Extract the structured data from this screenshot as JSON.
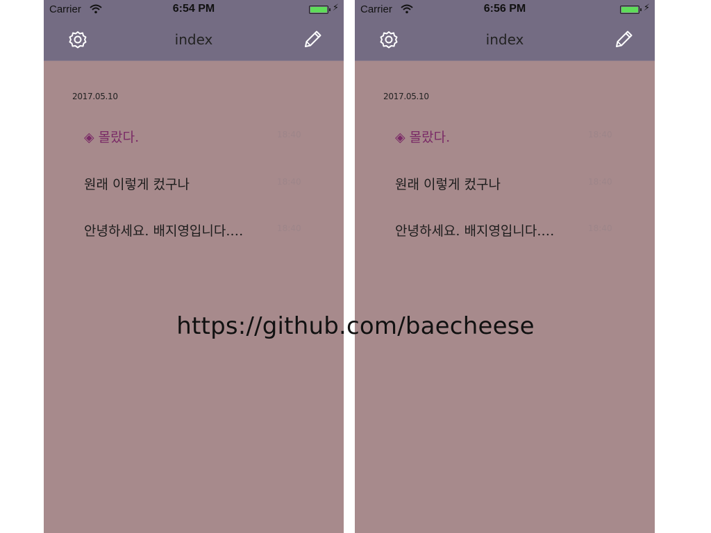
{
  "screens": [
    {
      "status": {
        "carrier": "Carrier",
        "time": "6:54 PM"
      },
      "nav": {
        "title": "index"
      },
      "list": {
        "date": "2017.05.10",
        "items": [
          {
            "marker": "◈",
            "title": "몰랐다.",
            "time": "18:40"
          },
          {
            "title": "원래 이렇게 컸구나",
            "time": "18:40"
          },
          {
            "title": "안녕하세요. 배지영입니다.…",
            "time": "18:40"
          }
        ]
      }
    },
    {
      "status": {
        "carrier": "Carrier",
        "time": "6:56 PM"
      },
      "nav": {
        "title": "index"
      },
      "list": {
        "date": "2017.05.10",
        "items": [
          {
            "marker": "◈",
            "title": "몰랐다.",
            "time": "18:40"
          },
          {
            "title": "원래 이렇게 컸구나",
            "time": "18:40"
          },
          {
            "title": "안녕하세요. 배지영입니다.…",
            "time": "18:40"
          }
        ]
      }
    }
  ],
  "icons": [
    "wifi-icon",
    "battery-icon",
    "charging-bolt-icon",
    "gear-icon",
    "pencil-icon",
    "diamond-marker-icon"
  ],
  "colors": {
    "background": "#a78a8c",
    "navbar": "#746c83",
    "selected_text": "#7a2a66",
    "time_text": "#9d8589",
    "battery": "#5fdc5a"
  },
  "watermark": "https://github.com/baecheese"
}
